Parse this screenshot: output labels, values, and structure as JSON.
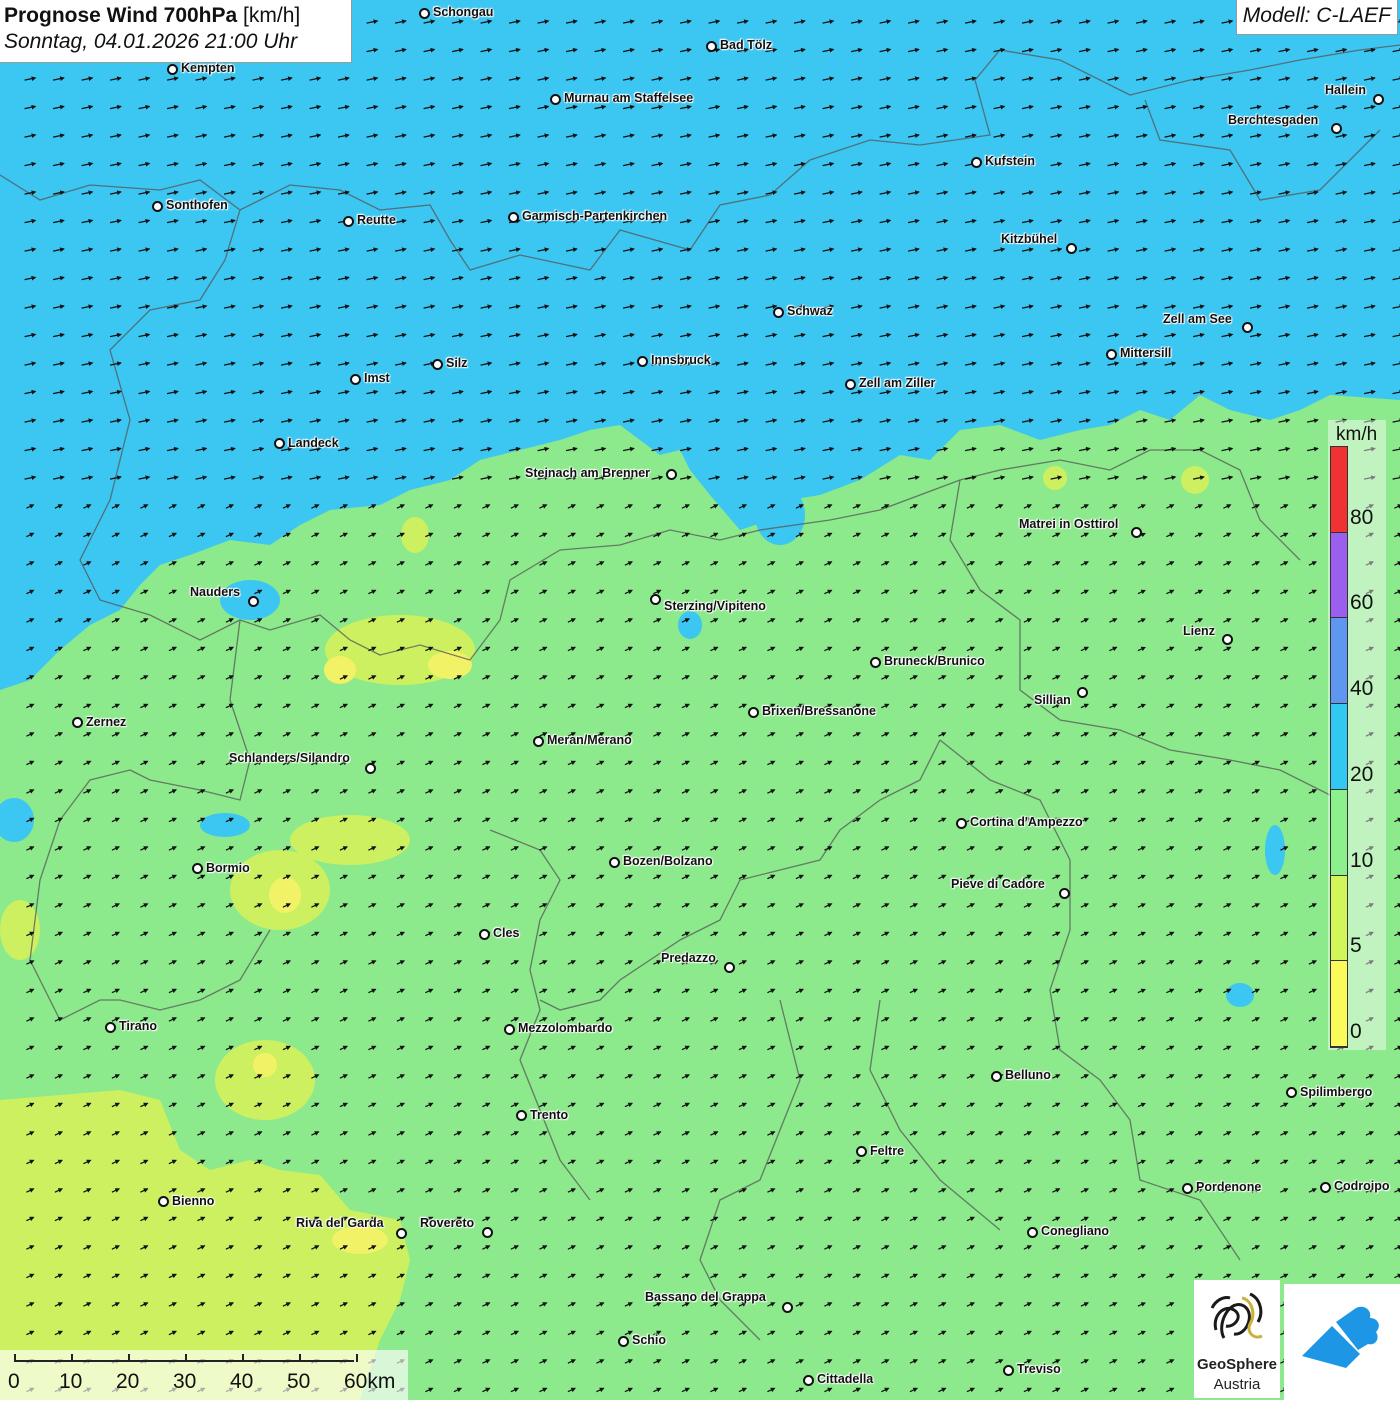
{
  "header": {
    "title_bold": "Prognose Wind 700hPa",
    "title_unit": "[km/h]",
    "subtitle": "Sonntag, 04.01.2026 21:00 Uhr",
    "model": "Modell: C-LAEF"
  },
  "legend": {
    "unit": "km/h",
    "labels": [
      "0",
      "5",
      "10",
      "20",
      "40",
      "60",
      "80"
    ],
    "colors": [
      "#fafa5a",
      "#d2f55a",
      "#8cf08c",
      "#32c8f0",
      "#5f96f0",
      "#9b5ff0",
      "#f03232"
    ]
  },
  "scale_bar": {
    "labels": [
      "0",
      "10",
      "20",
      "30",
      "40",
      "50",
      "60km"
    ]
  },
  "logos": {
    "geosphere_name": "GeoSphere",
    "geosphere_sub": "Austria"
  },
  "map": {
    "wind_direction": "west-southwest to east-northeast"
  },
  "cities": [
    {
      "name": "Schongau",
      "label": "Schongau"
    },
    {
      "name": "Bad-Toelz",
      "label": "Bad Tölz"
    },
    {
      "name": "Kempten",
      "label": "Kempten"
    },
    {
      "name": "Murnau",
      "label": "Murnau am Staffelsee"
    },
    {
      "name": "Hallein",
      "label": "Hallein"
    },
    {
      "name": "Berchtesgaden",
      "label": "Berchtesgaden"
    },
    {
      "name": "Kufstein",
      "label": "Kufstein"
    },
    {
      "name": "Sonthofen",
      "label": "Sonthofen"
    },
    {
      "name": "Reutte",
      "label": "Reutte"
    },
    {
      "name": "Garmisch",
      "label": "Garmisch-Partenkirchen"
    },
    {
      "name": "Kitzbuehel",
      "label": "Kitzbühel"
    },
    {
      "name": "Schwaz",
      "label": "Schwaz"
    },
    {
      "name": "Zell-am-See",
      "label": "Zell am See"
    },
    {
      "name": "Mittersill",
      "label": "Mittersill"
    },
    {
      "name": "Innsbruck",
      "label": "Innsbruck"
    },
    {
      "name": "Silz",
      "label": "Silz"
    },
    {
      "name": "Imst",
      "label": "Imst"
    },
    {
      "name": "Zell-am-Ziller",
      "label": "Zell am Ziller"
    },
    {
      "name": "Landeck",
      "label": "Landeck"
    },
    {
      "name": "Steinach",
      "label": "Steinach am Brenner"
    },
    {
      "name": "Matrei",
      "label": "Matrei in Osttirol"
    },
    {
      "name": "Nauders",
      "label": "Nauders"
    },
    {
      "name": "Sterzing",
      "label": "Sterzing/Vipiteno"
    },
    {
      "name": "Lienz",
      "label": "Lienz"
    },
    {
      "name": "Bruneck",
      "label": "Bruneck/Brunico"
    },
    {
      "name": "Sillian",
      "label": "Sillian"
    },
    {
      "name": "Brixen",
      "label": "Brixen/Bressanone"
    },
    {
      "name": "Zernez",
      "label": "Zernez"
    },
    {
      "name": "Meran",
      "label": "Meran/Merano"
    },
    {
      "name": "Schlanders",
      "label": "Schlanders/Silandro"
    },
    {
      "name": "Cortina",
      "label": "Cortina d'Ampezzo"
    },
    {
      "name": "Bozen",
      "label": "Bozen/Bolzano"
    },
    {
      "name": "Bormio",
      "label": "Bormio"
    },
    {
      "name": "Pieve",
      "label": "Pieve di Cadore"
    },
    {
      "name": "Cles",
      "label": "Cles"
    },
    {
      "name": "Predazzo",
      "label": "Predazzo"
    },
    {
      "name": "Tirano",
      "label": "Tirano"
    },
    {
      "name": "Mezzolombardo",
      "label": "Mezzolombardo"
    },
    {
      "name": "Belluno",
      "label": "Belluno"
    },
    {
      "name": "Spilimbergo",
      "label": "Spilimbergo"
    },
    {
      "name": "Trento",
      "label": "Trento"
    },
    {
      "name": "Feltre",
      "label": "Feltre"
    },
    {
      "name": "Bienno",
      "label": "Bienno"
    },
    {
      "name": "Pordenone",
      "label": "Pordenone"
    },
    {
      "name": "Codroipo",
      "label": "Codroipo"
    },
    {
      "name": "Riva",
      "label": "Riva del Garda"
    },
    {
      "name": "Rovereto",
      "label": "Rovereto"
    },
    {
      "name": "Conegliano",
      "label": "Conegliano"
    },
    {
      "name": "Bassano",
      "label": "Bassano del Grappa"
    },
    {
      "name": "Schio",
      "label": "Schio"
    },
    {
      "name": "Treviso",
      "label": "Treviso"
    },
    {
      "name": "Cittadella",
      "label": "Cittadella"
    }
  ]
}
